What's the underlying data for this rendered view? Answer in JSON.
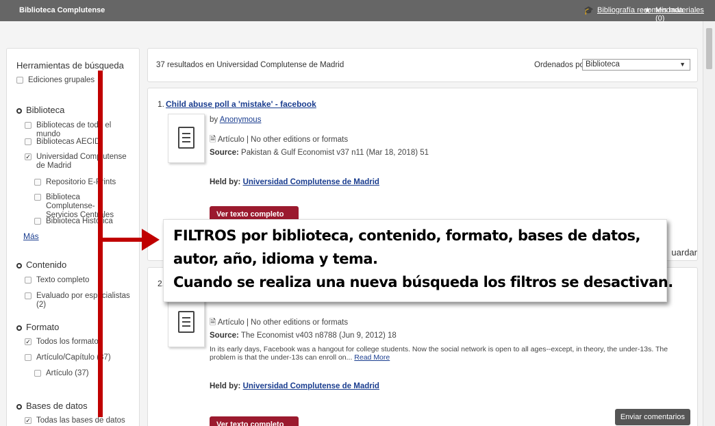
{
  "topbar": {
    "brand": "Biblioteca Complutense",
    "recommended": "Bibliografía recomendada",
    "materials": "Mis materiales (0)"
  },
  "sidebar": {
    "title": "Herramientas de búsqueda",
    "group_editions": "Ediciones grupales",
    "library": {
      "label": "Biblioteca",
      "items": [
        {
          "label": "Bibliotecas de todo el mundo",
          "checked": false
        },
        {
          "label": "Bibliotecas AECID",
          "checked": false
        },
        {
          "label": "Universidad Complutense de Madrid",
          "checked": true
        },
        {
          "label": "Repositorio E-Prints",
          "checked": false
        },
        {
          "label": "Biblioteca Complutense-Servicios Centrales",
          "checked": false
        },
        {
          "label": "Biblioteca Histórica",
          "checked": false
        }
      ],
      "more": "Más"
    },
    "content": {
      "label": "Contenido",
      "items": [
        {
          "label": "Texto completo",
          "checked": false
        },
        {
          "label": "Evaluado por especialistas (2)",
          "checked": false
        }
      ]
    },
    "format": {
      "label": "Formato",
      "items": [
        {
          "label": "Todos los formatos",
          "checked": true
        },
        {
          "label": "Artículo/Capítulo (37)",
          "checked": false
        },
        {
          "label": "Artículo (37)",
          "checked": false
        }
      ]
    },
    "databases": {
      "label": "Bases de datos",
      "items": [
        {
          "label": "Todas las bases de datos",
          "checked": true
        }
      ]
    }
  },
  "results": {
    "count_text": "37 resultados en Universidad Complutense de Madrid",
    "sort_label": "Ordenados por:",
    "sort_value": "Biblioteca"
  },
  "items": [
    {
      "num": "1.",
      "title": "Child abuse poll a 'mistake' - facebook",
      "by_prefix": "by",
      "author": "Anonymous",
      "format_line": "Artículo | No other editions or formats",
      "source_label": "Source:",
      "source": "Pakistan & Gulf Economist v37 n11 (Mar 18, 2018) 51",
      "held_label": "Held by:",
      "held_by": "Universidad Complutense de Madrid",
      "fulltext_button": "Ver texto completo"
    },
    {
      "num": "2.",
      "format_line": "Artículo | No other editions or formats",
      "source_label": "Source:",
      "source": "The Economist v403 n8788 (Jun 9, 2012) 18",
      "abstract": "In its early days, Facebook was a hangout for college students. Now the social network is open to all ages--except, in theory, the under-13s. The problem is that the under-13s can enroll on...",
      "read_more": "Read More",
      "held_label": "Held by:",
      "held_by": "Universidad Complutense de Madrid",
      "fulltext_button": "Ver texto completo",
      "feedback_button": "Enviar comentarios"
    }
  ],
  "save_button": "uardar",
  "overlay": {
    "line1": "FILTROS  por biblioteca, contenido, formato, bases de datos,",
    "line2": "autor, año, idioma y tema.",
    "line3": "Cuando se realiza una nueva búsqueda los filtros se desactivan."
  },
  "colors": {
    "topbar": "#666666",
    "link": "#1a3d8f",
    "fulltext_button": "#9b1a2e",
    "annotation": "#c00000"
  }
}
